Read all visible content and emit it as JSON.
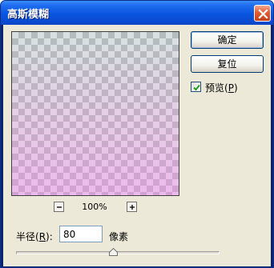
{
  "window": {
    "title": "高斯模糊"
  },
  "buttons": {
    "ok_label": "确定",
    "reset_label": "复位"
  },
  "preview": {
    "label": "预览",
    "hotkey": "P",
    "checked": true
  },
  "zoom": {
    "level": "100%"
  },
  "radius": {
    "label": "半径",
    "hotkey": "R",
    "value": "80",
    "unit": "像素"
  },
  "slider": {
    "position": 0.48
  },
  "colors": {
    "title_bar": "#0a55e0",
    "dialog_bg": "#ece9d8",
    "close_button": "#e25c33",
    "preview_tint": "#dc82dc"
  }
}
